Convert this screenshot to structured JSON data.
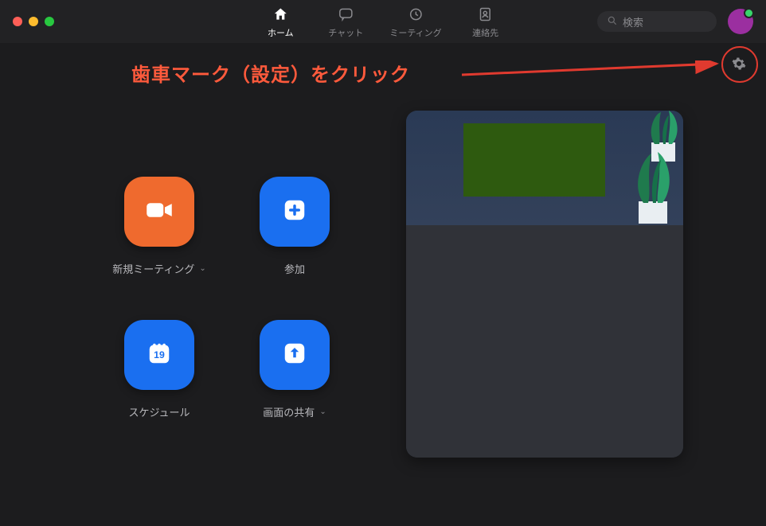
{
  "nav": {
    "home": "ホーム",
    "chat": "チャット",
    "meetings": "ミーティング",
    "contacts": "連絡先"
  },
  "search": {
    "placeholder": "検索"
  },
  "annotation": {
    "text": "歯車マーク（設定）をクリック"
  },
  "actions": {
    "new_meeting": "新規ミーティング",
    "join": "参加",
    "schedule": "スケジュール",
    "schedule_day": "19",
    "share_screen": "画面の共有"
  }
}
